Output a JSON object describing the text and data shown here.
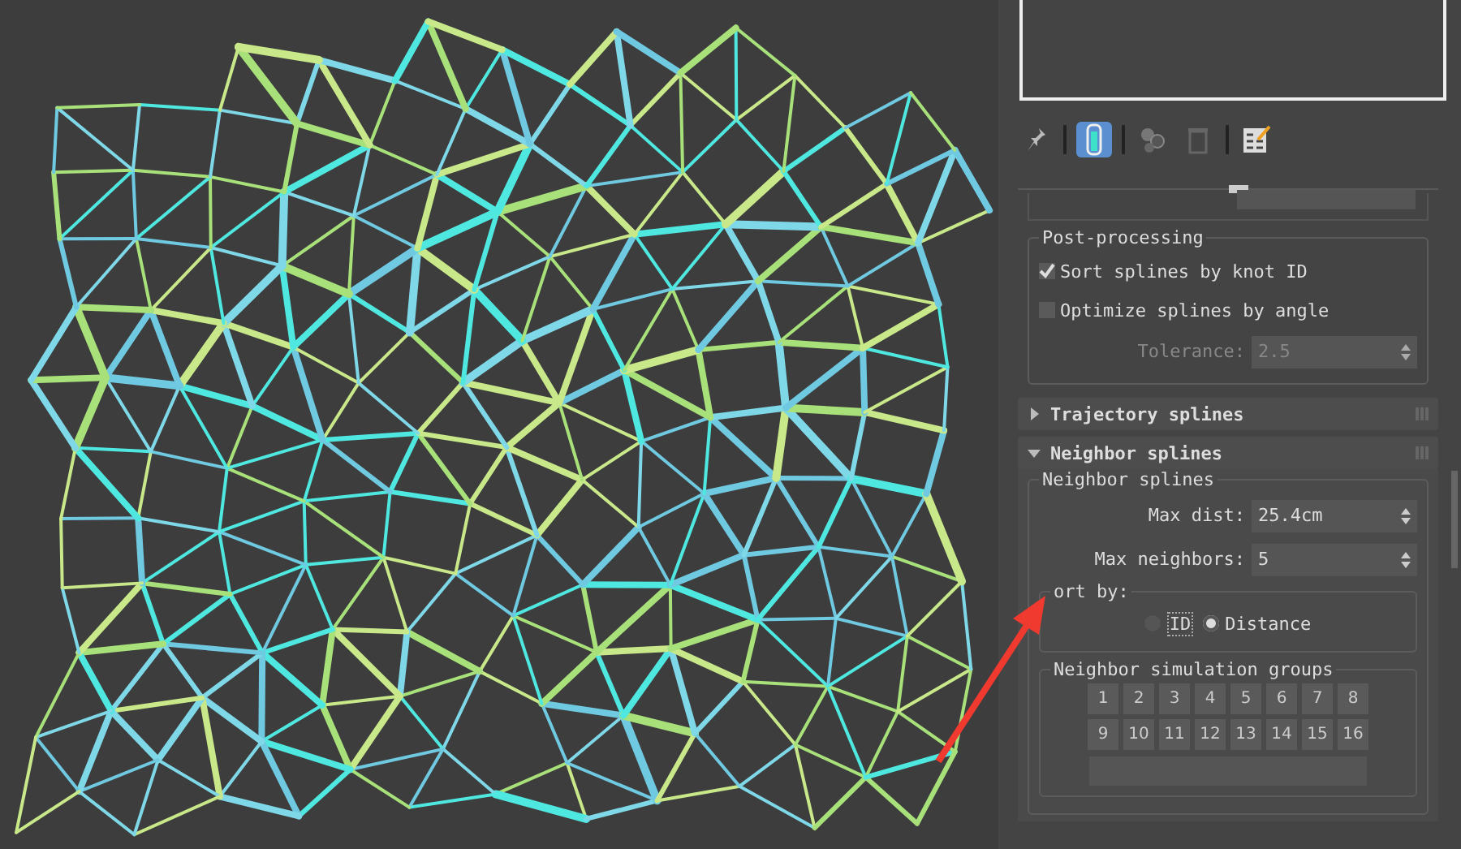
{
  "toolbar": [
    {
      "selected": false
    },
    {
      "selected": true
    },
    {
      "selected": false
    },
    {
      "selected": false
    },
    {
      "selected": false
    }
  ],
  "post_processing": {
    "title": "Post-processing",
    "options": [
      {
        "label": "Sort splines by knot ID",
        "checked": true
      },
      {
        "label": "Optimize splines by angle",
        "checked": false
      }
    ],
    "tolerance": {
      "label": "Tolerance:",
      "value": "2.5",
      "disabled": true
    }
  },
  "rollouts": [
    {
      "title": "Trajectory splines",
      "expanded": false
    },
    {
      "title": "Neighbor splines",
      "expanded": true
    }
  ],
  "neighbor": {
    "title": "Neighbor splines",
    "fields": [
      {
        "label": "Max dist:",
        "value": "25.4cm"
      },
      {
        "label": "Max neighbors:",
        "value": "5"
      }
    ],
    "sort_by": {
      "title": "ort by:",
      "options": [
        {
          "label": "ID",
          "selected": false
        },
        {
          "label": "Distance",
          "selected": true
        }
      ]
    },
    "groups": {
      "title": "Neighbor simulation groups",
      "buttons": [
        "1",
        "2",
        "3",
        "4",
        "5",
        "6",
        "7",
        "8",
        "9",
        "10",
        "11",
        "12",
        "13",
        "14",
        "15",
        "16"
      ]
    }
  }
}
